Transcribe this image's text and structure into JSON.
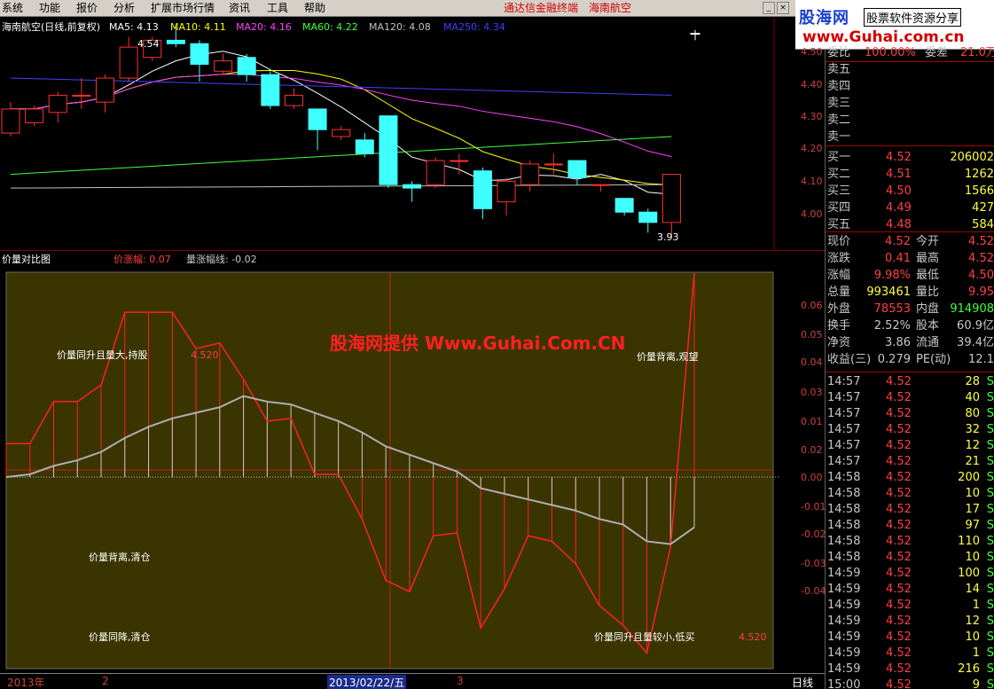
{
  "menu": {
    "items": [
      "系统",
      "功能",
      "报价",
      "分析",
      "扩展市场行情",
      "资讯",
      "工具",
      "帮助"
    ],
    "red_items": [
      "通达信金融终端",
      "海南航空"
    ]
  },
  "window": {
    "min_label": "_",
    "close_label": "×"
  },
  "logo": {
    "line1": "股海网",
    "line2": "股票软件资源分享",
    "line3": "www.Guhai.com.cn"
  },
  "upper": {
    "stock": "海南航空(日线,前复权)",
    "ma": [
      {
        "label": "MA5: 4.13",
        "color": "#ffffff"
      },
      {
        "label": "MA10: 4.11",
        "color": "#ffff00"
      },
      {
        "label": "MA20: 4.16",
        "color": "#ff40ff"
      },
      {
        "label": "MA60: 4.22",
        "color": "#40ff40"
      },
      {
        "label": "MA120: 4.08",
        "color": "#c0c0c0"
      },
      {
        "label": "MA250: 4.34",
        "color": "#4040ff"
      }
    ],
    "high_label": "4.54",
    "low_label": "3.93",
    "y_labels": [
      "4.50",
      "4.40",
      "4.30",
      "4.20",
      "4.10",
      "4.00"
    ]
  },
  "lower": {
    "title": "价量对比图",
    "ind1": "价涨幅: 0.07",
    "ind2": "量涨幅线: -0.02",
    "watermark": "股海网提供 Www.Guhai.Com.CN",
    "notes": {
      "tl": "价量同升且量大,持股",
      "tr": "价量背离,观望",
      "ml": "价量背离,清仓",
      "bl": "价量同降,清仓",
      "br": "价量同升且量较小,低买"
    },
    "val_tl": "4.520",
    "val_br": "4.520",
    "y_labels": [
      "0.06",
      "0.05",
      "0.04",
      "0.03",
      "0.02",
      "0.01",
      "0.00",
      "-0.01",
      "-0.02",
      "-0.03",
      "-0.04"
    ]
  },
  "footer": {
    "year": "2013年",
    "m2": "2",
    "date": "2013/02/22/五",
    "m3": "3",
    "period": "日线"
  },
  "quote": {
    "top": {
      "k1": "委比",
      "v1": "100.00%",
      "k2": "委差",
      "v2": "21.0万"
    },
    "sells": [
      "卖五",
      "卖四",
      "卖三",
      "卖二",
      "卖一"
    ],
    "buys": [
      {
        "label": "买一",
        "price": "4.52",
        "vol": "206002"
      },
      {
        "label": "买二",
        "price": "4.51",
        "vol": "1262"
      },
      {
        "label": "买三",
        "price": "4.50",
        "vol": "1566"
      },
      {
        "label": "买四",
        "price": "4.49",
        "vol": "427"
      },
      {
        "label": "买五",
        "price": "4.48",
        "vol": "584"
      }
    ],
    "stats": [
      {
        "k1": "现价",
        "v1": "4.52",
        "c1": "red",
        "k2": "今开",
        "v2": "4.52",
        "c2": "red"
      },
      {
        "k1": "涨跌",
        "v1": "0.41",
        "c1": "red",
        "k2": "最高",
        "v2": "4.52",
        "c2": "red"
      },
      {
        "k1": "涨幅",
        "v1": "9.98%",
        "c1": "red",
        "k2": "最低",
        "v2": "4.50",
        "c2": "red"
      },
      {
        "k1": "总量",
        "v1": "993461",
        "c1": "yel",
        "k2": "量比",
        "v2": "9.95",
        "c2": "red"
      },
      {
        "k1": "外盘",
        "v1": "78553",
        "c1": "red",
        "k2": "内盘",
        "v2": "914908",
        "c2": "grn"
      },
      {
        "k1": "换手",
        "v1": "2.52%",
        "c1": "gray",
        "k2": "股本",
        "v2": "60.9亿",
        "c2": "gray"
      },
      {
        "k1": "净资",
        "v1": "3.86",
        "c1": "gray",
        "k2": "流通",
        "v2": "39.4亿",
        "c2": "gray"
      },
      {
        "k1": "收益(三)",
        "v1": "0.279",
        "c1": "gray",
        "k2": "PE(动)",
        "v2": "12.1",
        "c2": "gray"
      }
    ],
    "ticks": [
      {
        "time": "14:57",
        "price": "4.52",
        "vol": "28",
        "dir": "S"
      },
      {
        "time": "14:57",
        "price": "4.52",
        "vol": "40",
        "dir": "S"
      },
      {
        "time": "14:57",
        "price": "4.52",
        "vol": "80",
        "dir": "S"
      },
      {
        "time": "14:57",
        "price": "4.52",
        "vol": "32",
        "dir": "S"
      },
      {
        "time": "14:57",
        "price": "4.52",
        "vol": "12",
        "dir": "S"
      },
      {
        "time": "14:57",
        "price": "4.52",
        "vol": "21",
        "dir": "S"
      },
      {
        "time": "14:58",
        "price": "4.52",
        "vol": "200",
        "dir": "S"
      },
      {
        "time": "14:58",
        "price": "4.52",
        "vol": "10",
        "dir": "S"
      },
      {
        "time": "14:58",
        "price": "4.52",
        "vol": "17",
        "dir": "S"
      },
      {
        "time": "14:58",
        "price": "4.52",
        "vol": "97",
        "dir": "S"
      },
      {
        "time": "14:58",
        "price": "4.52",
        "vol": "110",
        "dir": "S"
      },
      {
        "time": "14:58",
        "price": "4.52",
        "vol": "10",
        "dir": "S"
      },
      {
        "time": "14:59",
        "price": "4.52",
        "vol": "100",
        "dir": "S"
      },
      {
        "time": "14:59",
        "price": "4.52",
        "vol": "14",
        "dir": "S"
      },
      {
        "time": "14:59",
        "price": "4.52",
        "vol": "1",
        "dir": "S"
      },
      {
        "time": "14:59",
        "price": "4.52",
        "vol": "12",
        "dir": "S"
      },
      {
        "time": "14:59",
        "price": "4.52",
        "vol": "10",
        "dir": "S"
      },
      {
        "time": "14:59",
        "price": "4.52",
        "vol": "1",
        "dir": "S"
      },
      {
        "time": "14:59",
        "price": "4.52",
        "vol": "216",
        "dir": "S"
      },
      {
        "time": "15:00",
        "price": "4.52",
        "vol": "9",
        "dir": "S"
      }
    ]
  },
  "chart_data": [
    {
      "type": "candlestick",
      "title": "海南航空(日线,前复权)",
      "ylim": [
        3.9,
        4.55
      ],
      "candles": [
        {
          "o": 4.23,
          "c": 4.3,
          "h": 4.32,
          "l": 4.22
        },
        {
          "o": 4.26,
          "c": 4.3,
          "h": 4.31,
          "l": 4.25
        },
        {
          "o": 4.29,
          "c": 4.34,
          "h": 4.35,
          "l": 4.26
        },
        {
          "o": 4.34,
          "c": 4.34,
          "h": 4.39,
          "l": 4.3
        },
        {
          "o": 4.32,
          "c": 4.39,
          "h": 4.4,
          "l": 4.29
        },
        {
          "o": 4.39,
          "c": 4.48,
          "h": 4.51,
          "l": 4.38
        },
        {
          "o": 4.45,
          "c": 4.5,
          "h": 4.51,
          "l": 4.44
        },
        {
          "o": 4.5,
          "c": 4.49,
          "h": 4.54,
          "l": 4.48
        },
        {
          "o": 4.49,
          "c": 4.43,
          "h": 4.5,
          "l": 4.38
        },
        {
          "o": 4.41,
          "c": 4.44,
          "h": 4.46,
          "l": 4.4
        },
        {
          "o": 4.45,
          "c": 4.4,
          "h": 4.46,
          "l": 4.38
        },
        {
          "o": 4.4,
          "c": 4.31,
          "h": 4.41,
          "l": 4.3
        },
        {
          "o": 4.31,
          "c": 4.34,
          "h": 4.36,
          "l": 4.3
        },
        {
          "o": 4.3,
          "c": 4.24,
          "h": 4.3,
          "l": 4.18
        },
        {
          "o": 4.22,
          "c": 4.24,
          "h": 4.25,
          "l": 4.21
        },
        {
          "o": 4.21,
          "c": 4.17,
          "h": 4.23,
          "l": 4.16
        },
        {
          "o": 4.28,
          "c": 4.08,
          "h": 4.28,
          "l": 4.07
        },
        {
          "o": 4.08,
          "c": 4.07,
          "h": 4.09,
          "l": 4.03
        },
        {
          "o": 4.08,
          "c": 4.15,
          "h": 4.16,
          "l": 4.07
        },
        {
          "o": 4.15,
          "c": 4.15,
          "h": 4.17,
          "l": 4.11
        },
        {
          "o": 4.12,
          "c": 4.01,
          "h": 4.13,
          "l": 3.98
        },
        {
          "o": 4.03,
          "c": 4.09,
          "h": 4.1,
          "l": 3.99
        },
        {
          "o": 4.08,
          "c": 4.14,
          "h": 4.15,
          "l": 4.06
        },
        {
          "o": 4.14,
          "c": 4.14,
          "h": 4.17,
          "l": 4.11
        },
        {
          "o": 4.15,
          "c": 4.1,
          "h": 4.15,
          "l": 4.08
        },
        {
          "o": 4.08,
          "c": 4.08,
          "h": 4.08,
          "l": 4.06
        },
        {
          "o": 4.04,
          "c": 4.0,
          "h": 4.04,
          "l": 3.99
        },
        {
          "o": 4.0,
          "c": 3.97,
          "h": 4.01,
          "l": 3.94
        },
        {
          "o": 3.97,
          "c": 4.11,
          "h": 4.11,
          "l": 3.93
        },
        {
          "o": 4.52,
          "c": 4.52,
          "h": 4.53,
          "l": 4.5
        }
      ]
    },
    {
      "type": "line",
      "title": "价量对比图",
      "ylim": [
        -0.065,
        0.075
      ],
      "series": [
        {
          "name": "价涨幅",
          "values": [
            0.012,
            0.012,
            0.027,
            0.027,
            0.033,
            0.059,
            0.059,
            0.059,
            0.046,
            0.048,
            0.035,
            0.02,
            0.021,
            0.001,
            0.001,
            -0.015,
            -0.037,
            -0.041,
            -0.021,
            -0.02,
            -0.054,
            -0.04,
            -0.021,
            -0.023,
            -0.031,
            -0.046,
            -0.053,
            -0.063,
            -0.025,
            0.073
          ]
        },
        {
          "name": "量涨幅线",
          "values": [
            0.0,
            0.001,
            0.004,
            0.006,
            0.009,
            0.014,
            0.018,
            0.021,
            0.023,
            0.025,
            0.029,
            0.027,
            0.026,
            0.023,
            0.02,
            0.016,
            0.011,
            0.008,
            0.005,
            0.002,
            -0.004,
            -0.006,
            -0.008,
            -0.01,
            -0.012,
            -0.015,
            -0.017,
            -0.023,
            -0.024,
            -0.018
          ]
        }
      ]
    }
  ]
}
